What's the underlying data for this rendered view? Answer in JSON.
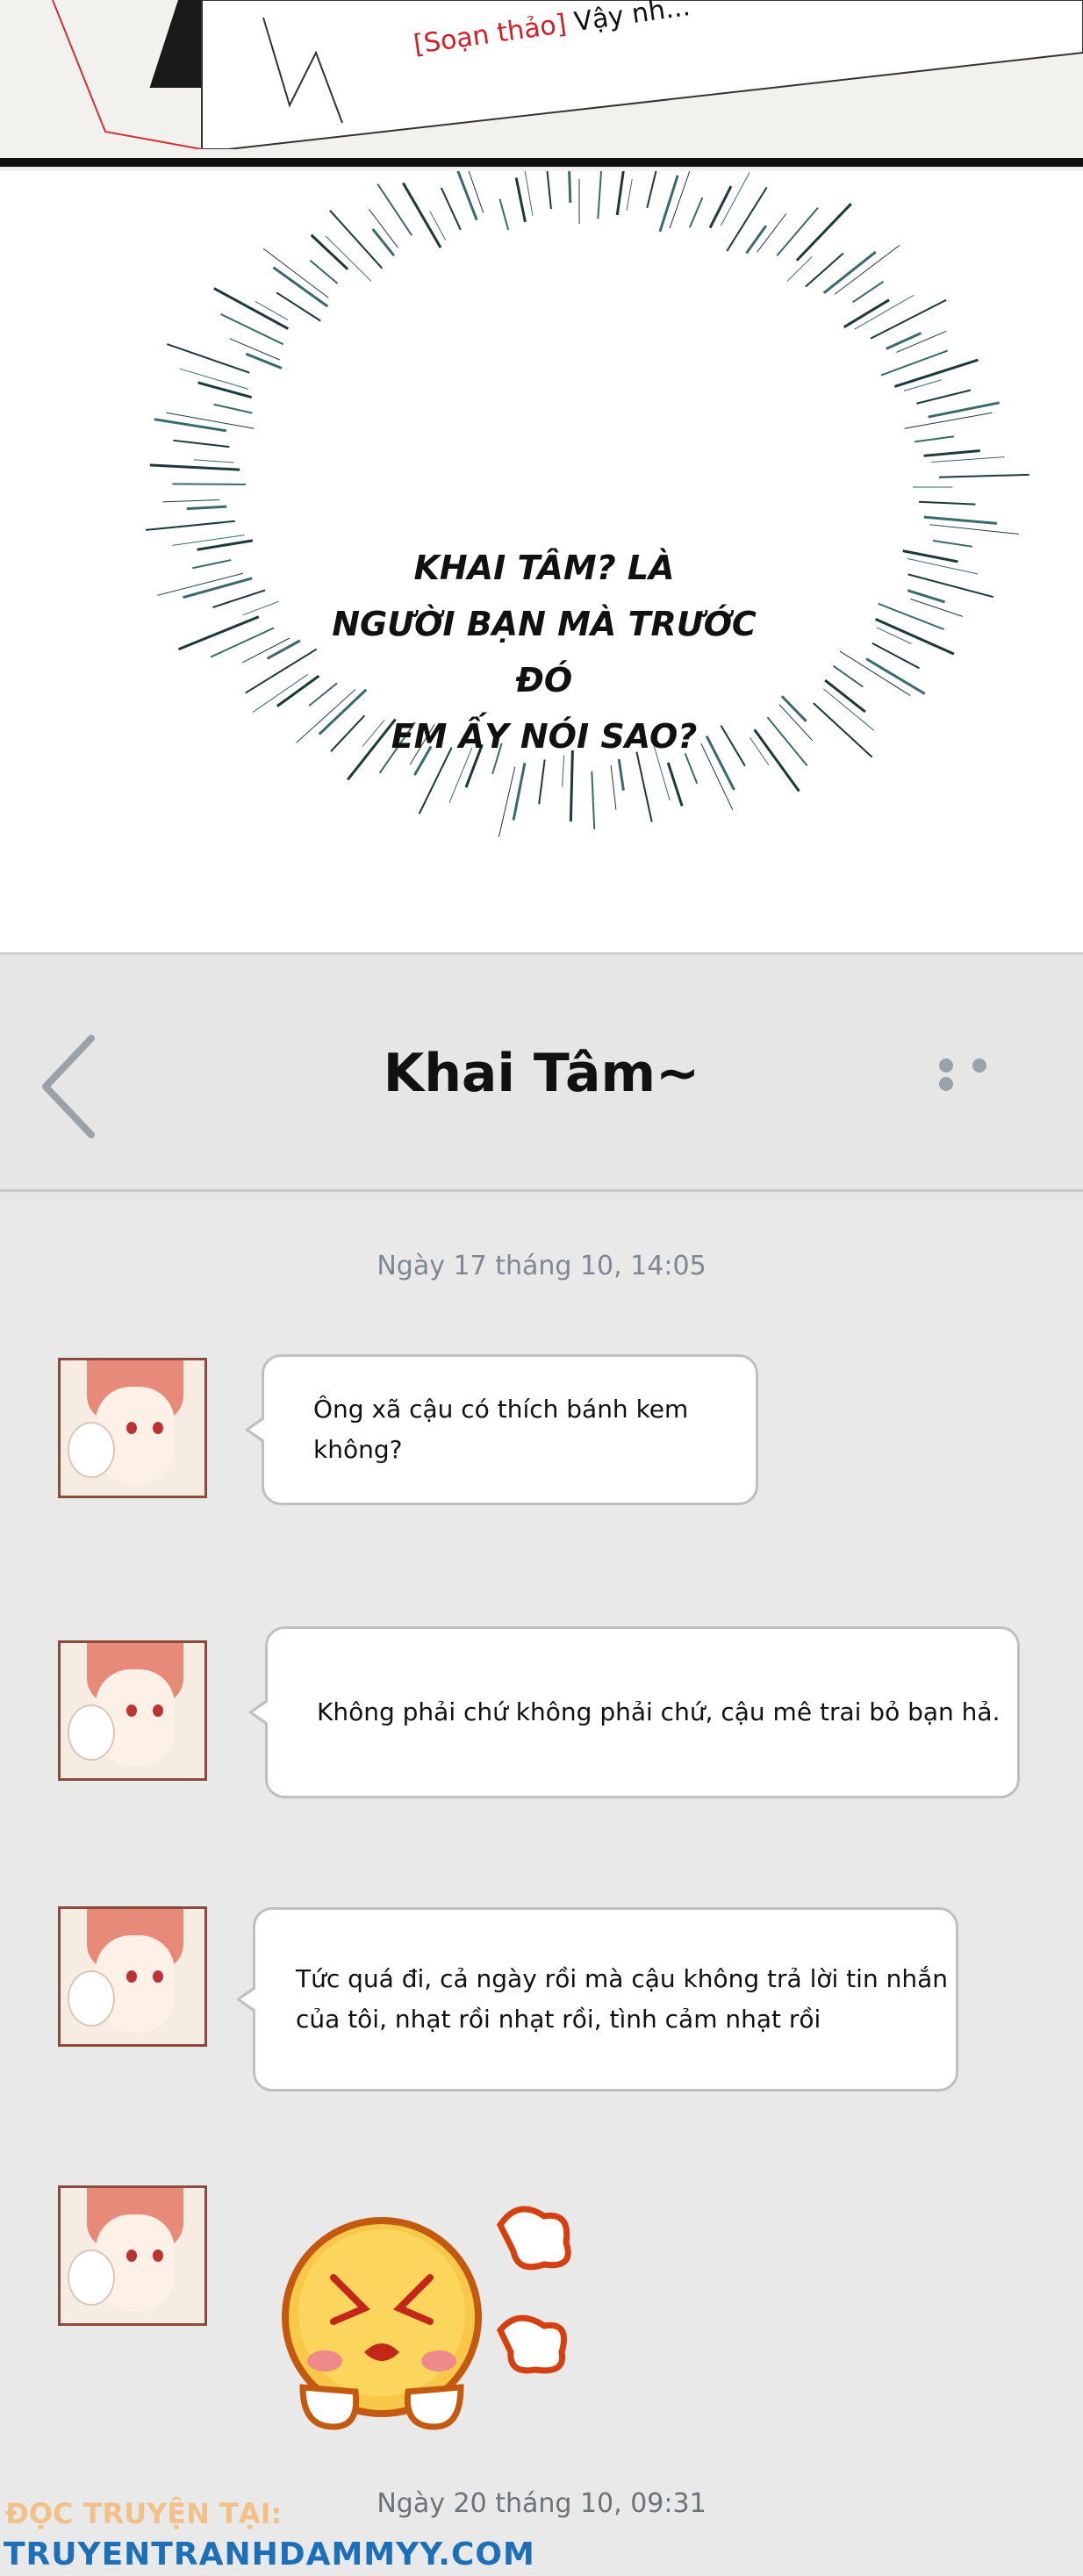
{
  "top_panel": {
    "draft_tag": "[Soạn thảo]",
    "draft_text": "Vậy nh..."
  },
  "burst": {
    "lines": [
      "KHAI TÂM? LÀ",
      "NGƯỜI BẠN MÀ TRƯỚC ĐÓ",
      "EM ẤY NÓI SAO?"
    ]
  },
  "chat": {
    "title": "Khai Tâm~",
    "date1": "Ngày 17 tháng 10, 14:05",
    "messages": [
      {
        "text": "Ông xã cậu có thích bánh kem không?"
      },
      {
        "text": "Không phải chứ không phải chứ, cậu mê trai bỏ bạn hả."
      },
      {
        "text_line1": "Tức quá đi, cả ngày rồi mà cậu không trả lời tin nhắn",
        "text_line2": "của tôi, nhạt rồi nhạt rồi, tình cảm nhạt rồi"
      }
    ],
    "date2": "Ngày 20 tháng 10, 09:31"
  },
  "watermark": {
    "line1": "ĐỌC TRUYỆN TẠI:",
    "line2": "TRUYENTRANHDAMMYY.COM"
  },
  "colors": {
    "draft_tag": "#d11f2a",
    "watermark_orange": "#f2c18a",
    "watermark_blue": "#1d6fb8",
    "chat_bg": "#e9e9e9"
  }
}
